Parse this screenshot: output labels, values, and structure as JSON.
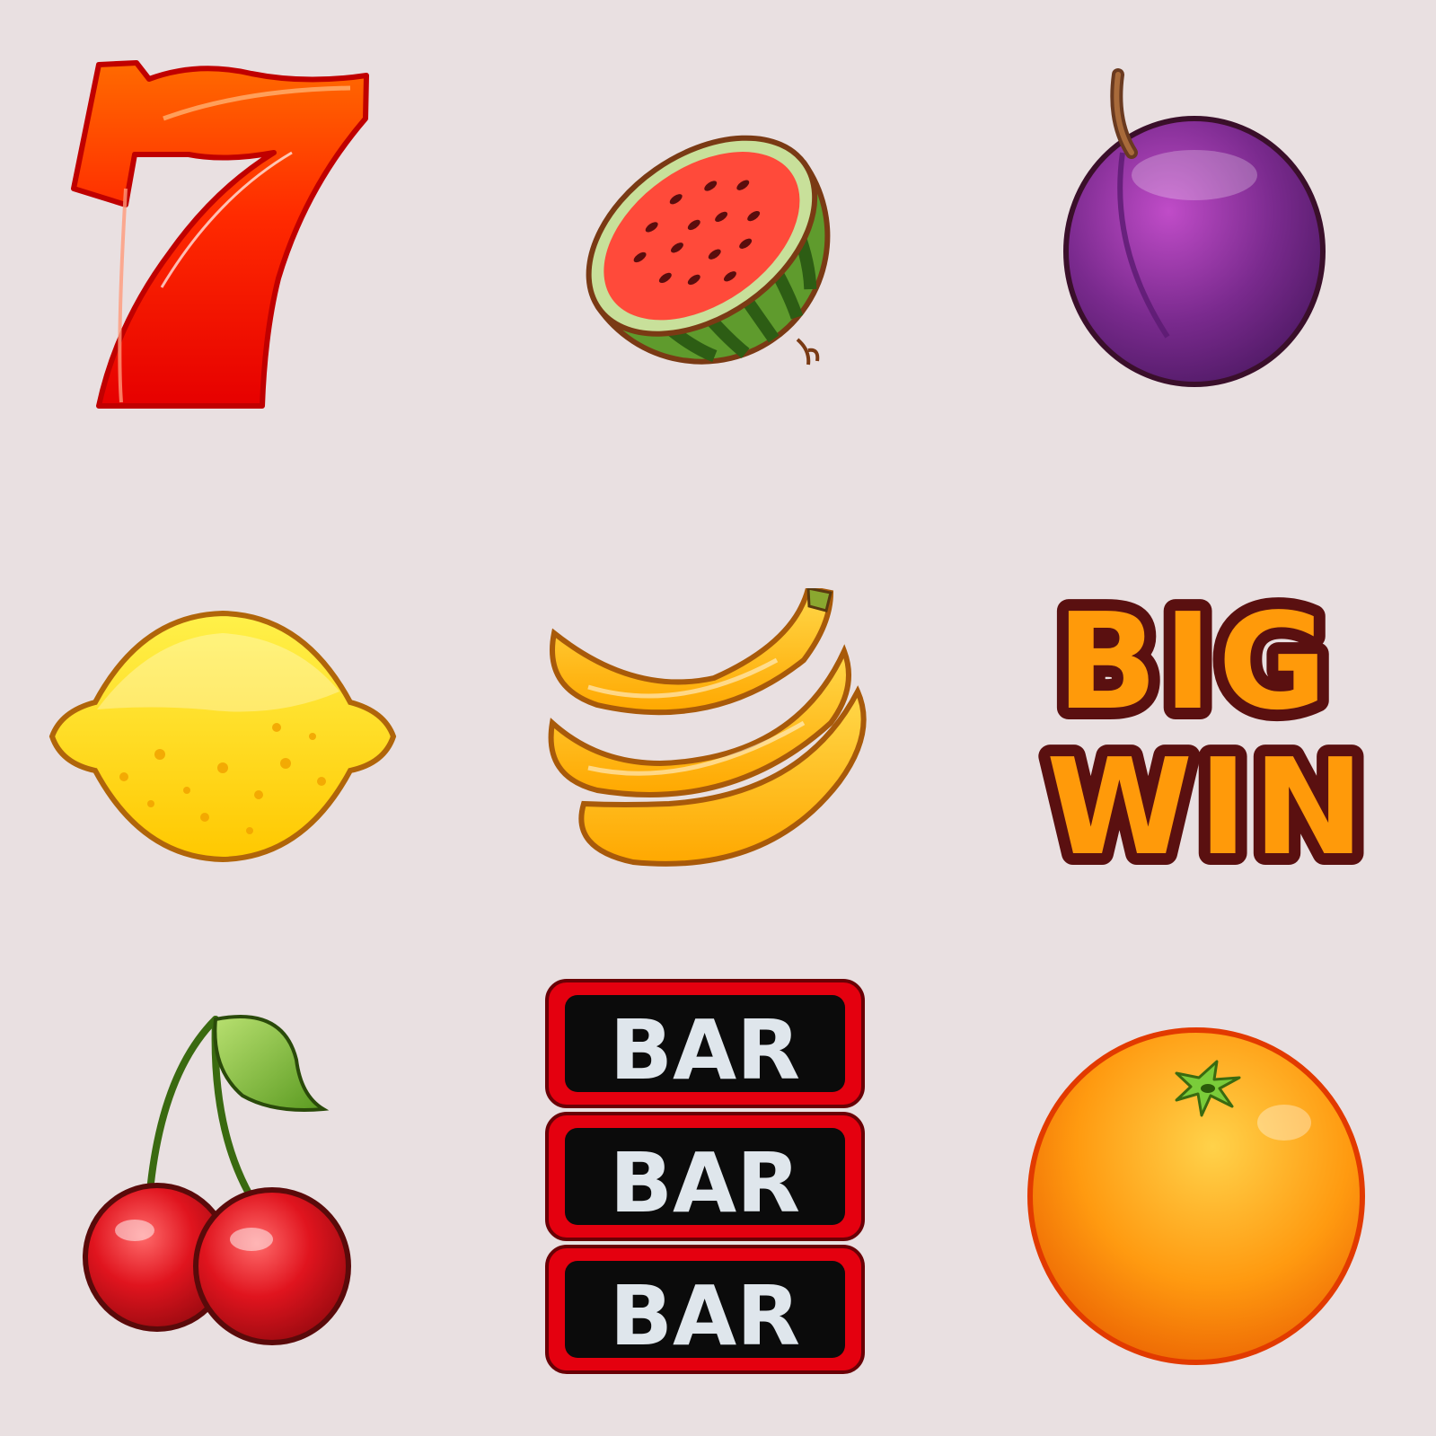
{
  "palette": {
    "background": "#e9e0e1",
    "outline_dark": "#5a1010",
    "seven_red": "#ff1a00",
    "seven_orange": "#ff5a00",
    "watermelon_flesh": "#ff4a3a",
    "watermelon_rind": "#4f8f2a",
    "plum_purple": "#7a2a8e",
    "lemon_yellow": "#ffd60a",
    "banana_yellow": "#ffbd12",
    "bigwin_orange": "#ff9a0a",
    "cherry_red": "#e0141e",
    "bar_red": "#e4000f",
    "bar_black": "#0b0b0b",
    "bar_text": "#dfe6ec",
    "orange_fruit": "#ff8a00"
  },
  "symbols": [
    {
      "id": "seven",
      "icon": "seven-icon",
      "label": "7"
    },
    {
      "id": "watermelon",
      "icon": "watermelon-icon"
    },
    {
      "id": "plum",
      "icon": "plum-icon"
    },
    {
      "id": "lemon",
      "icon": "lemon-icon"
    },
    {
      "id": "banana",
      "icon": "banana-icon"
    },
    {
      "id": "big-win",
      "icon": "big-win-icon",
      "lines": [
        "BIG",
        "WIN"
      ]
    },
    {
      "id": "cherry",
      "icon": "cherry-icon"
    },
    {
      "id": "triple-bar",
      "icon": "triple-bar-icon",
      "labels": [
        "BAR",
        "BAR",
        "BAR"
      ]
    },
    {
      "id": "orange",
      "icon": "orange-icon"
    }
  ]
}
